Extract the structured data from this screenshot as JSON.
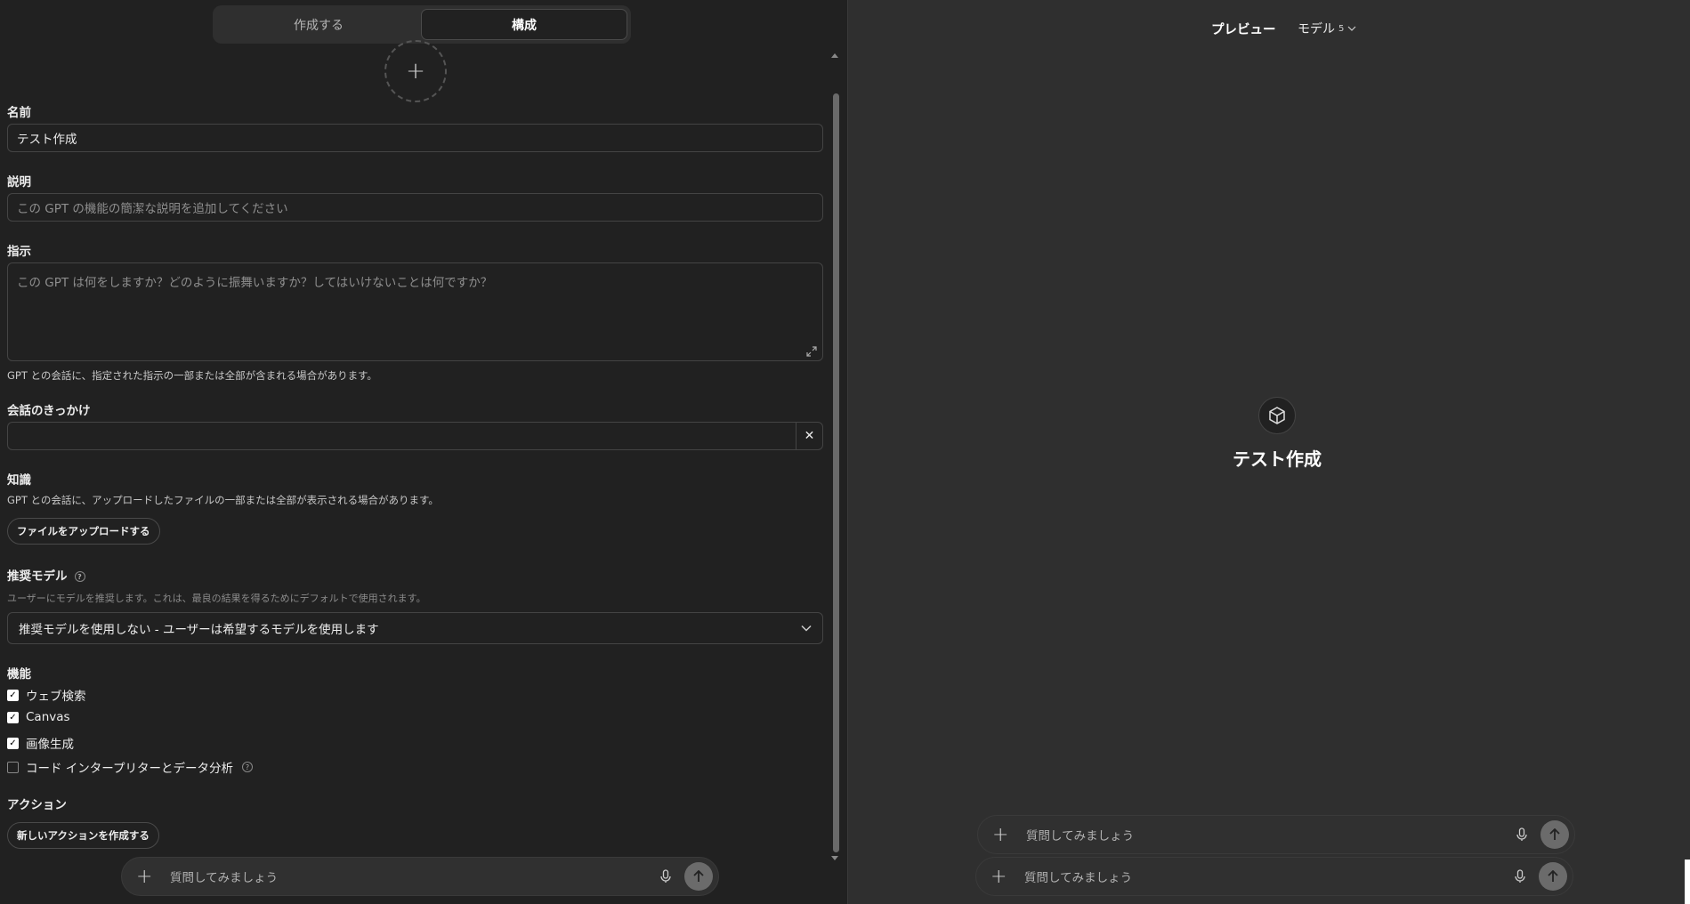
{
  "tabs": {
    "create": "作成する",
    "configure": "構成"
  },
  "avatar": {
    "add": "+"
  },
  "name": {
    "label": "名前",
    "value": "テスト作成"
  },
  "description": {
    "label": "説明",
    "placeholder": "この GPT の機能の簡潔な説明を追加してください"
  },
  "instructions": {
    "label": "指示",
    "placeholder": "この GPT は何をしますか？どのように振舞いますか？してはいけないことは何ですか？",
    "hint": "GPT との会話に、指定された指示の一部または全部が含まれる場合があります。"
  },
  "starters": {
    "label": "会話のきっかけ",
    "value": "",
    "clear": "✕"
  },
  "knowledge": {
    "label": "知識",
    "hint": "GPT との会話に、アップロードしたファイルの一部または全部が表示される場合があります。",
    "upload_button": "ファイルをアップロードする"
  },
  "recommended_model": {
    "label": "推奨モデル",
    "help": "?",
    "hint": "ユーザーにモデルを推奨します。これは、最良の結果を得るためにデフォルトで使用されます。",
    "selected": "推奨モデルを使用しない - ユーザーは希望するモデルを使用します"
  },
  "capabilities": {
    "label": "機能",
    "items": [
      {
        "label": "ウェブ検索",
        "checked": true
      },
      {
        "label": "Canvas",
        "checked": true
      },
      {
        "label": "画像生成",
        "checked": true
      },
      {
        "label": "コード インタープリターとデータ分析",
        "checked": false
      }
    ],
    "help": "?"
  },
  "actions": {
    "label": "アクション",
    "create_button": "新しいアクションを作成する"
  },
  "chat": {
    "placeholder": "質問してみましょう",
    "plus": "+"
  },
  "preview": {
    "title": "プレビュー",
    "model_label": "モデル",
    "model_num": "5",
    "gpt_name": "テスト作成"
  },
  "colors": {
    "bg_left": "#212121",
    "bg_right": "#2f2f2f",
    "border": "#444444"
  }
}
